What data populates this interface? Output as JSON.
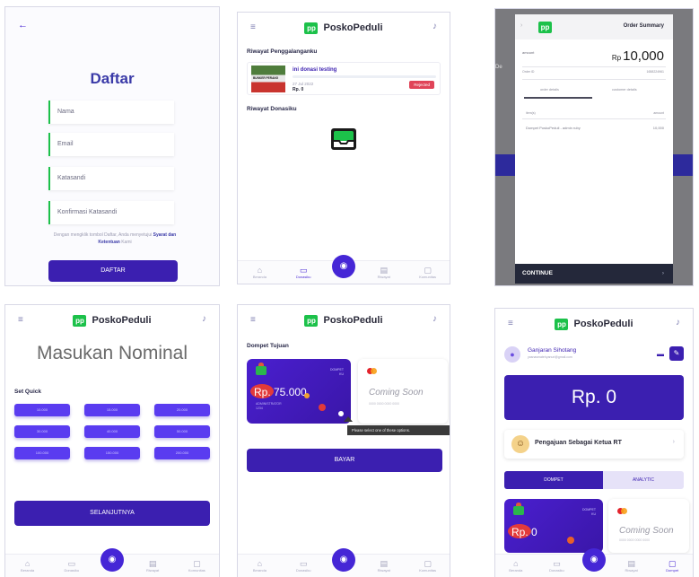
{
  "brand": "PoskoPeduli",
  "logo_text": "pp",
  "screen1": {
    "title": "Daftar",
    "fields": [
      "Nama",
      "Email",
      "Katasandi",
      "Konfirmasi Katasandi"
    ],
    "terms_prefix": "Dengan mengklik tombol Daftar, Anda menyetujui",
    "terms_link": "Syarat dan Ketentuan",
    "terms_suffix": "Kami",
    "button": "DAFTAR"
  },
  "screen2": {
    "section1": "Riwayat Penggalanganku",
    "fundraise_title": "ini donasi testing",
    "fundraise_date": "27 Jul 2022",
    "fundraise_amount": "Rp. 0",
    "thumb_caption": "BUNKER PERANG",
    "status": "Rejected",
    "section2": "Riwayat Donasiku"
  },
  "screen3": {
    "header_title": "Order Summary",
    "amount_label": "amount",
    "currency": "Rp",
    "amount": "10,000",
    "order_label": "Order ID",
    "order_value": "1658224961",
    "tab1": "order details",
    "tab2": "customer details",
    "col1": "item(s)",
    "col2": "amount",
    "item_name": "Dompet PoskoPeduli - admin ruby",
    "item_amount": "10,000",
    "side_text": "De",
    "footer": "CONTINUE"
  },
  "screen4": {
    "title": "Masukan Nominal",
    "quick_label": "Set Quick",
    "quick_amounts": [
      "10.000",
      "15.000",
      "20.000",
      "30.000",
      "40.000",
      "50.000",
      "100.000",
      "150.000",
      "200.000"
    ],
    "button": "SELANJUTNYA"
  },
  "screen5": {
    "section": "Dompet Tujuan",
    "wallet_type": "DOMPET\nKU",
    "wallet_balance": "Rp. 75.000",
    "wallet_sub": "ADMINISTRATOR\n1234",
    "coming_soon": "Coming Soon",
    "coming_sub": "0000 0000 0000 0000",
    "tooltip": "Please select one of these options.",
    "button": "BAYAR"
  },
  "screen6": {
    "name": "Ganjaran Sihotang",
    "email": "yasnasmatehyanuri@gmail.com",
    "balance": "Rp. 0",
    "rt_label": "Pengajuan Sebagai Ketua RT",
    "tab_dompet": "DOMPET",
    "tab_analytic": "ANALYTIC",
    "wallet_balance": "Rp. 0",
    "wallet_type": "DOMPET\nKU",
    "coming_soon": "Coming Soon",
    "coming_sub": "0000 0000 0000 0000"
  },
  "nav": [
    "Beranda",
    "Donasiku",
    "Dompet",
    "Riwayat",
    "Komunitas"
  ],
  "colors": {
    "primary": "#3b1fb0",
    "accent": "#5a3cf0",
    "brand_green": "#1cc14a",
    "danger": "#e04458"
  },
  "icons": {
    "back": "←",
    "menu": "≡",
    "bell": "♪",
    "wallet": "◉",
    "chevron": "›",
    "edit": "✎",
    "card": "▬"
  }
}
